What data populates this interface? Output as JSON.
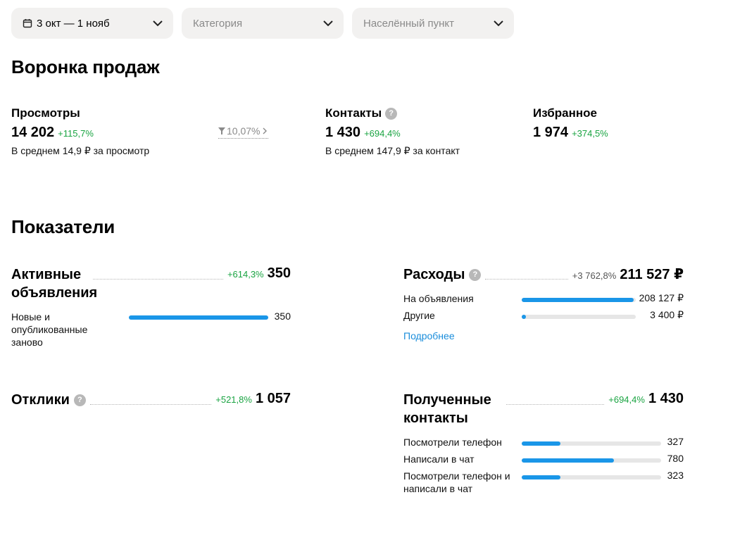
{
  "filters": {
    "date": "3 окт — 1 нояб",
    "category_placeholder": "Категория",
    "location_placeholder": "Населённый пункт"
  },
  "funnel": {
    "title": "Воронка продаж",
    "views": {
      "label": "Просмотры",
      "value": "14 202",
      "change": "+115,7%",
      "avg": "В среднем 14,9 ₽ за просмотр"
    },
    "conversion": "10,07%",
    "contacts": {
      "label": "Контакты",
      "value": "1 430",
      "change": "+694,4%",
      "avg": "В среднем 147,9 ₽ за контакт"
    },
    "favorites": {
      "label": "Избранное",
      "value": "1 974",
      "change": "+374,5%"
    }
  },
  "indicators": {
    "title": "Показатели",
    "active_ads": {
      "title": "Активные объявления",
      "change": "+614,3%",
      "value": "350",
      "rows": [
        {
          "label": "Новые и опубликованные заново",
          "value": "350",
          "fill": 1.0
        }
      ]
    },
    "expenses": {
      "title": "Расходы",
      "change": "+3 762,8%",
      "value": "211 527 ₽",
      "rows": [
        {
          "label": "На объявления",
          "value": "208 127 ₽",
          "fill": 0.984
        },
        {
          "label": "Другие",
          "value": "3 400 ₽",
          "fill": 0.04
        }
      ],
      "more_link": "Подробнее"
    },
    "responses": {
      "title": "Отклики",
      "change": "+521,8%",
      "value": "1 057"
    },
    "received_contacts": {
      "title": "Полученные контакты",
      "change": "+694,4%",
      "value": "1 430",
      "rows": [
        {
          "label": "Посмотрели телефон",
          "value": "327",
          "fill": 0.28
        },
        {
          "label": "Написали в чат",
          "value": "780",
          "fill": 0.66
        },
        {
          "label": "Посмотрели телефон и написали в чат",
          "value": "323",
          "fill": 0.28
        }
      ]
    }
  },
  "colors": {
    "accent": "#1a96e8",
    "positive": "#1aa442",
    "track": "#e6e6e6",
    "filter_bg": "#f2f1f0"
  }
}
